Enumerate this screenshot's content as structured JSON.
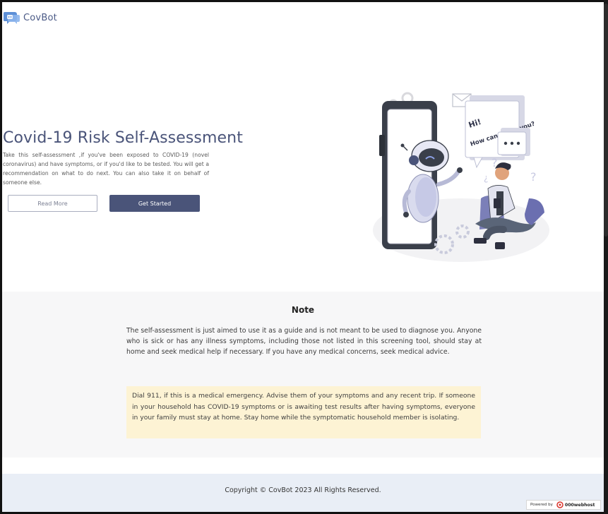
{
  "header": {
    "logo_text": "CovBot"
  },
  "hero": {
    "title": "Covid-19 Risk Self-Assessment",
    "description": "Take this self-assessment ,if you've been exposed to COVID-19 (novel coronavirus) and have symptoms, or if you'd like to be tested. You will get a recommendation on what to do next. You can also take it on behalf of someone else.",
    "read_more_label": "Read More",
    "get_started_label": "Get Started",
    "bubble_text_line1": "Hi!",
    "bubble_text_line2": "How can I help you?"
  },
  "note": {
    "title": "Note",
    "text": "The self-assessment is just aimed to use it as a guide and is not meant to be used to diagnose you. Anyone who is sick or has any illness symptoms, including those not listed in this screening tool, should stay at home and seek medical help if necessary. If you have any medical concerns, seek medical advice.",
    "alert": "Dial 911, if this is a medical emergency. Advise them of your symptoms and any recent trip. If someone in your household has COVID-19 symptoms or is awaiting test results after having symptoms, everyone in your family must stay at home. Stay home while the symptomatic household member is isolating."
  },
  "footer": {
    "copyright": "Copyright © CovBot 2023 All Rights Reserved.",
    "badge_prefix": "Powered by",
    "badge_name": "000webhost"
  },
  "colors": {
    "brand": "#4a5479",
    "note_bg": "#f7f7f8",
    "alert_bg": "#fdf3d4",
    "footer_bg": "#e9eef6"
  }
}
